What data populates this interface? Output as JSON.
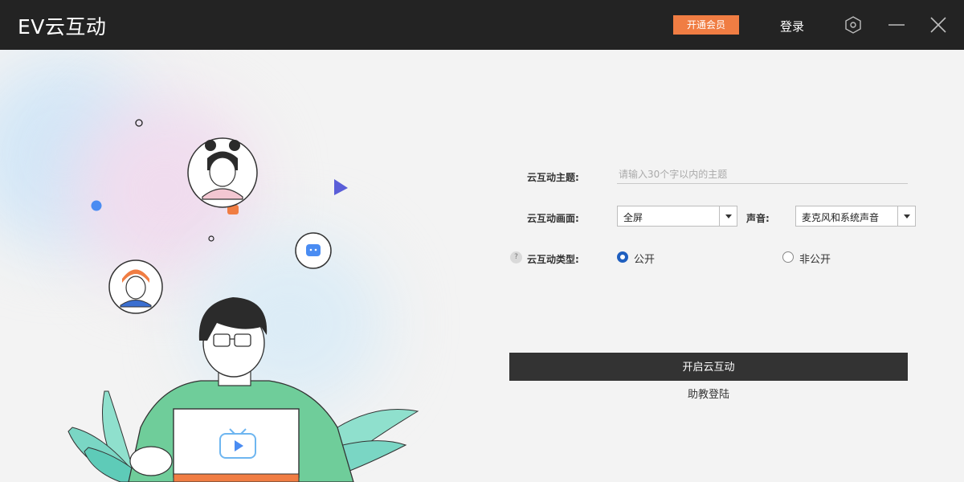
{
  "titlebar": {
    "app_title": "EV云互动",
    "vip_label": "开通会员",
    "login_label": "登录",
    "icons": [
      "settings-hexagon-icon",
      "minimize-icon",
      "close-icon"
    ],
    "vip_color": "#f07d43",
    "background": "#232323"
  },
  "form": {
    "topic_label": "云互动主题:",
    "topic_placeholder": "请输入30个字以内的主题",
    "screen_label": "云互动画面:",
    "screen_value": "全屏",
    "sound_label": "声音:",
    "sound_value": "麦克风和系统声音",
    "type_help": "?",
    "type_label": "云互动类型:",
    "type_options": [
      {
        "label": "公开",
        "checked": true
      },
      {
        "label": "非公开",
        "checked": false
      }
    ],
    "start_label": "开启云互动",
    "assistant_login_label": "助教登陆",
    "accent_color": "#1f5fbf"
  }
}
